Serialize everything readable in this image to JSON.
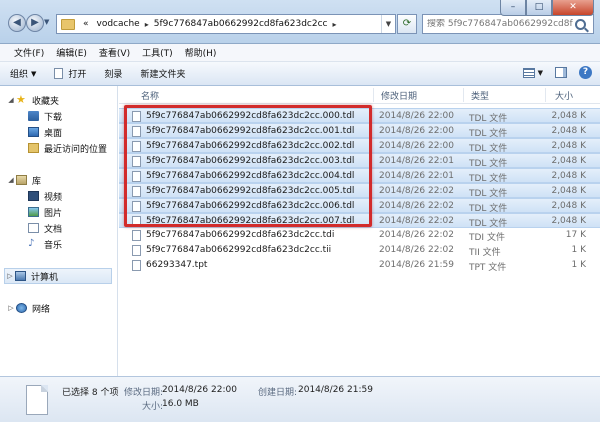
{
  "window": {
    "address": {
      "prefix": "«",
      "segments": [
        "vodcache",
        "5f9c776847ab0662992cd8fa623dc2cc"
      ]
    },
    "search_placeholder": "搜索 5f9c776847ab0662992cd8fa6...",
    "controls": {
      "min": "–",
      "max": "□",
      "close": "✕"
    }
  },
  "menubar": [
    "文件(F)",
    "编辑(E)",
    "查看(V)",
    "工具(T)",
    "帮助(H)"
  ],
  "toolbar": {
    "organize": "组织",
    "open": "打开",
    "burn": "刻录",
    "new_folder": "新建文件夹"
  },
  "navpane": {
    "favorites": "收藏夹",
    "fav_items": [
      "下载",
      "桌面",
      "最近访问的位置"
    ],
    "libraries": "库",
    "lib_items": [
      "视频",
      "图片",
      "文档",
      "音乐"
    ],
    "computer": "计算机",
    "network": "网络"
  },
  "columns": {
    "name": "名称",
    "date": "修改日期",
    "type": "类型",
    "size": "大小"
  },
  "files": [
    {
      "name": "5f9c776847ab0662992cd8fa623dc2cc.000.tdl",
      "date": "2014/8/26 22:00",
      "type": "TDL 文件",
      "size": "2,048 K",
      "selected": true
    },
    {
      "name": "5f9c776847ab0662992cd8fa623dc2cc.001.tdl",
      "date": "2014/8/26 22:00",
      "type": "TDL 文件",
      "size": "2,048 K",
      "selected": true
    },
    {
      "name": "5f9c776847ab0662992cd8fa623dc2cc.002.tdl",
      "date": "2014/8/26 22:00",
      "type": "TDL 文件",
      "size": "2,048 K",
      "selected": true
    },
    {
      "name": "5f9c776847ab0662992cd8fa623dc2cc.003.tdl",
      "date": "2014/8/26 22:01",
      "type": "TDL 文件",
      "size": "2,048 K",
      "selected": true
    },
    {
      "name": "5f9c776847ab0662992cd8fa623dc2cc.004.tdl",
      "date": "2014/8/26 22:01",
      "type": "TDL 文件",
      "size": "2,048 K",
      "selected": true
    },
    {
      "name": "5f9c776847ab0662992cd8fa623dc2cc.005.tdl",
      "date": "2014/8/26 22:02",
      "type": "TDL 文件",
      "size": "2,048 K",
      "selected": true
    },
    {
      "name": "5f9c776847ab0662992cd8fa623dc2cc.006.tdl",
      "date": "2014/8/26 22:02",
      "type": "TDL 文件",
      "size": "2,048 K",
      "selected": true
    },
    {
      "name": "5f9c776847ab0662992cd8fa623dc2cc.007.tdl",
      "date": "2014/8/26 22:02",
      "type": "TDL 文件",
      "size": "2,048 K",
      "selected": true
    },
    {
      "name": "5f9c776847ab0662992cd8fa623dc2cc.tdi",
      "date": "2014/8/26 22:02",
      "type": "TDI 文件",
      "size": "17 K",
      "selected": false
    },
    {
      "name": "5f9c776847ab0662992cd8fa623dc2cc.tii",
      "date": "2014/8/26 22:02",
      "type": "TII 文件",
      "size": "1 K",
      "selected": false
    },
    {
      "name": "66293347.tpt",
      "date": "2014/8/26 21:59",
      "type": "TPT 文件",
      "size": "1 K",
      "selected": false
    }
  ],
  "details": {
    "selection": "已选择 8 个项",
    "modified_label": "修改日期:",
    "modified_value": "2014/8/26 22:00",
    "created_label": "创建日期:",
    "created_value": "2014/8/26 21:59",
    "size_label": "大小:",
    "size_value": "16.0 MB"
  }
}
